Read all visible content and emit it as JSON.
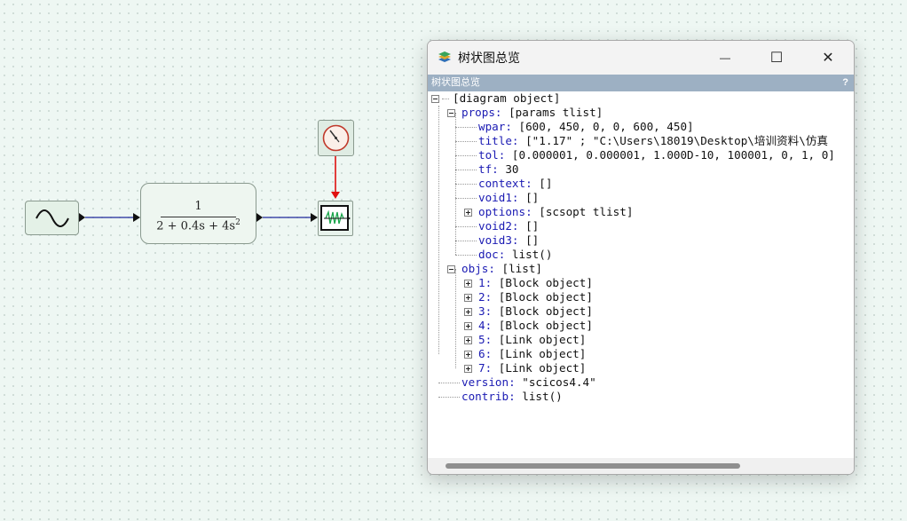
{
  "diagram": {
    "transfer_function": {
      "numerator": "1",
      "denominator": "2 + 0.4s + 4s"
    }
  },
  "window": {
    "title": "树状图总览",
    "subtitle": "树状图总览",
    "help": "?",
    "controls": {
      "minimize": "—",
      "maximize": "☐",
      "close": "✕"
    }
  },
  "tree": [
    {
      "key": "",
      "value": "[diagram object]"
    },
    {
      "key": "props:",
      "value": " [params tlist]"
    },
    {
      "key": "wpar:",
      "value": " [600, 450, 0, 0, 600, 450]"
    },
    {
      "key": "title:",
      "value": " [\"1.17\" ; \"C:\\Users\\18019\\Desktop\\培训资料\\仿真"
    },
    {
      "key": "tol:",
      "value": " [0.000001, 0.000001, 1.000D-10, 100001, 0, 1, 0]"
    },
    {
      "key": "tf:",
      "value": " 30"
    },
    {
      "key": "context:",
      "value": " []"
    },
    {
      "key": "void1:",
      "value": " []"
    },
    {
      "key": "options:",
      "value": " [scsopt tlist]"
    },
    {
      "key": "void2:",
      "value": " []"
    },
    {
      "key": "void3:",
      "value": " []"
    },
    {
      "key": "doc:",
      "value": " list()"
    },
    {
      "key": "objs:",
      "value": " [list]"
    },
    {
      "key": "1:",
      "value": " [Block object]"
    },
    {
      "key": "2:",
      "value": " [Block object]"
    },
    {
      "key": "3:",
      "value": " [Block object]"
    },
    {
      "key": "4:",
      "value": " [Block object]"
    },
    {
      "key": "5:",
      "value": " [Link object]"
    },
    {
      "key": "6:",
      "value": " [Link object]"
    },
    {
      "key": "7:",
      "value": " [Link object]"
    },
    {
      "key": "version:",
      "value": " \"scicos4.4\""
    },
    {
      "key": "contrib:",
      "value": " list()"
    }
  ]
}
